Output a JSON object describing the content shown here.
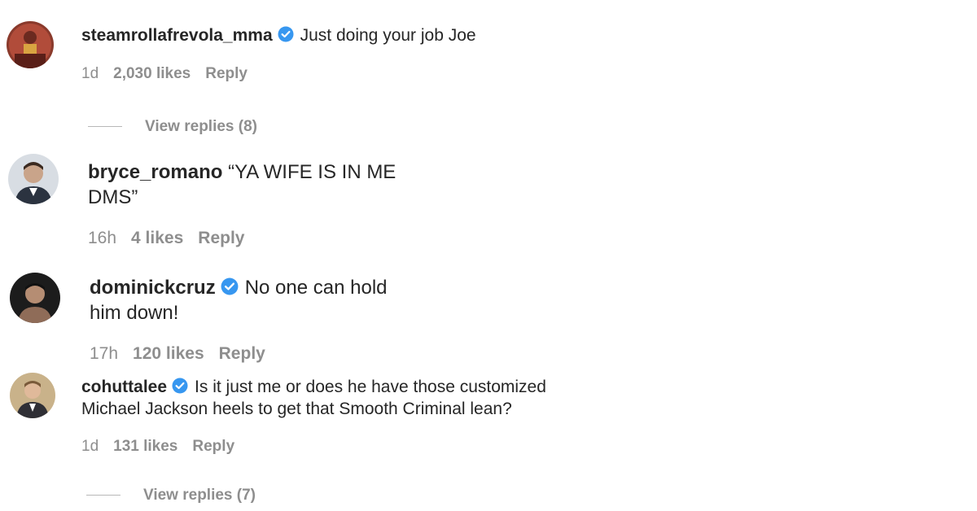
{
  "comments": [
    {
      "username": "steamrollafrevola_mma",
      "verified": true,
      "text": "Just doing your job Joe",
      "time": "1d",
      "likes": "2,030 likes",
      "reply": "Reply",
      "view_replies": "View replies (8)"
    },
    {
      "username": "bryce_romano",
      "verified": false,
      "text_line1": "“YA WIFE IS IN ME",
      "text_line2": "DMS”",
      "time": "16h",
      "likes": "4 likes",
      "reply": "Reply"
    },
    {
      "username": "dominickcruz",
      "verified": true,
      "text_line1": "No one can hold",
      "text_line2": "him down!",
      "time": "17h",
      "likes": "120 likes",
      "reply": "Reply"
    },
    {
      "username": "cohuttalee",
      "verified": true,
      "text_line1": "Is it just me or does he have those customized",
      "text_line2": "Michael Jackson heels to get that Smooth Criminal lean?",
      "time": "1d",
      "likes": "131 likes",
      "reply": "Reply",
      "view_replies": "View replies (7)"
    }
  ],
  "colors": {
    "verified_badge": "#3797f0",
    "secondary_text": "#8e8e8e",
    "primary_text": "#262626"
  }
}
